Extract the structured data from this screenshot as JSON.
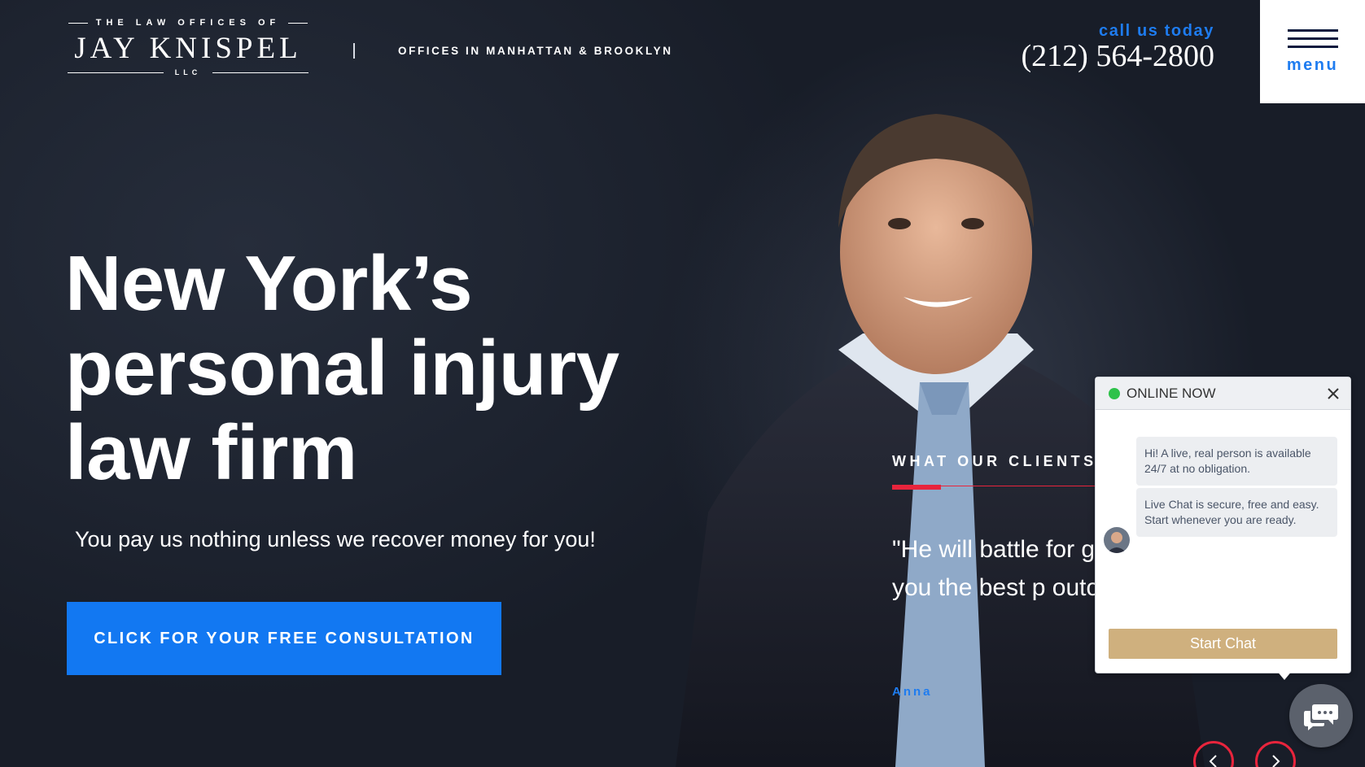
{
  "header": {
    "logo_top": "THE LAW OFFICES OF",
    "logo_name": "JAY KNISPEL",
    "logo_suffix": "LLC",
    "offices": "OFFICES IN MANHATTAN & BROOKLYN",
    "call_label": "call us today",
    "phone": "(212) 564-2800",
    "menu_label": "menu"
  },
  "hero": {
    "headline": "New York’s personal injury law firm",
    "subhead": "You pay us nothing unless we recover money for you!",
    "cta_label": "CLICK FOR YOUR FREE CONSULTATION"
  },
  "testimonial": {
    "title": "WHAT OUR CLIENTS",
    "quote": "\"He will battle for get you the best p outcome\"",
    "author": "Anna"
  },
  "chat": {
    "status": "ONLINE NOW",
    "messages": [
      "Hi! A live, real person is available 24/7 at no obligation.",
      "Live Chat is secure, free and easy. Start whenever you are ready."
    ],
    "start_label": "Start Chat"
  },
  "colors": {
    "accent_blue": "#1278f2",
    "accent_red": "#e8243c",
    "chat_button": "#cfb07e",
    "online_green": "#2ec24a"
  }
}
